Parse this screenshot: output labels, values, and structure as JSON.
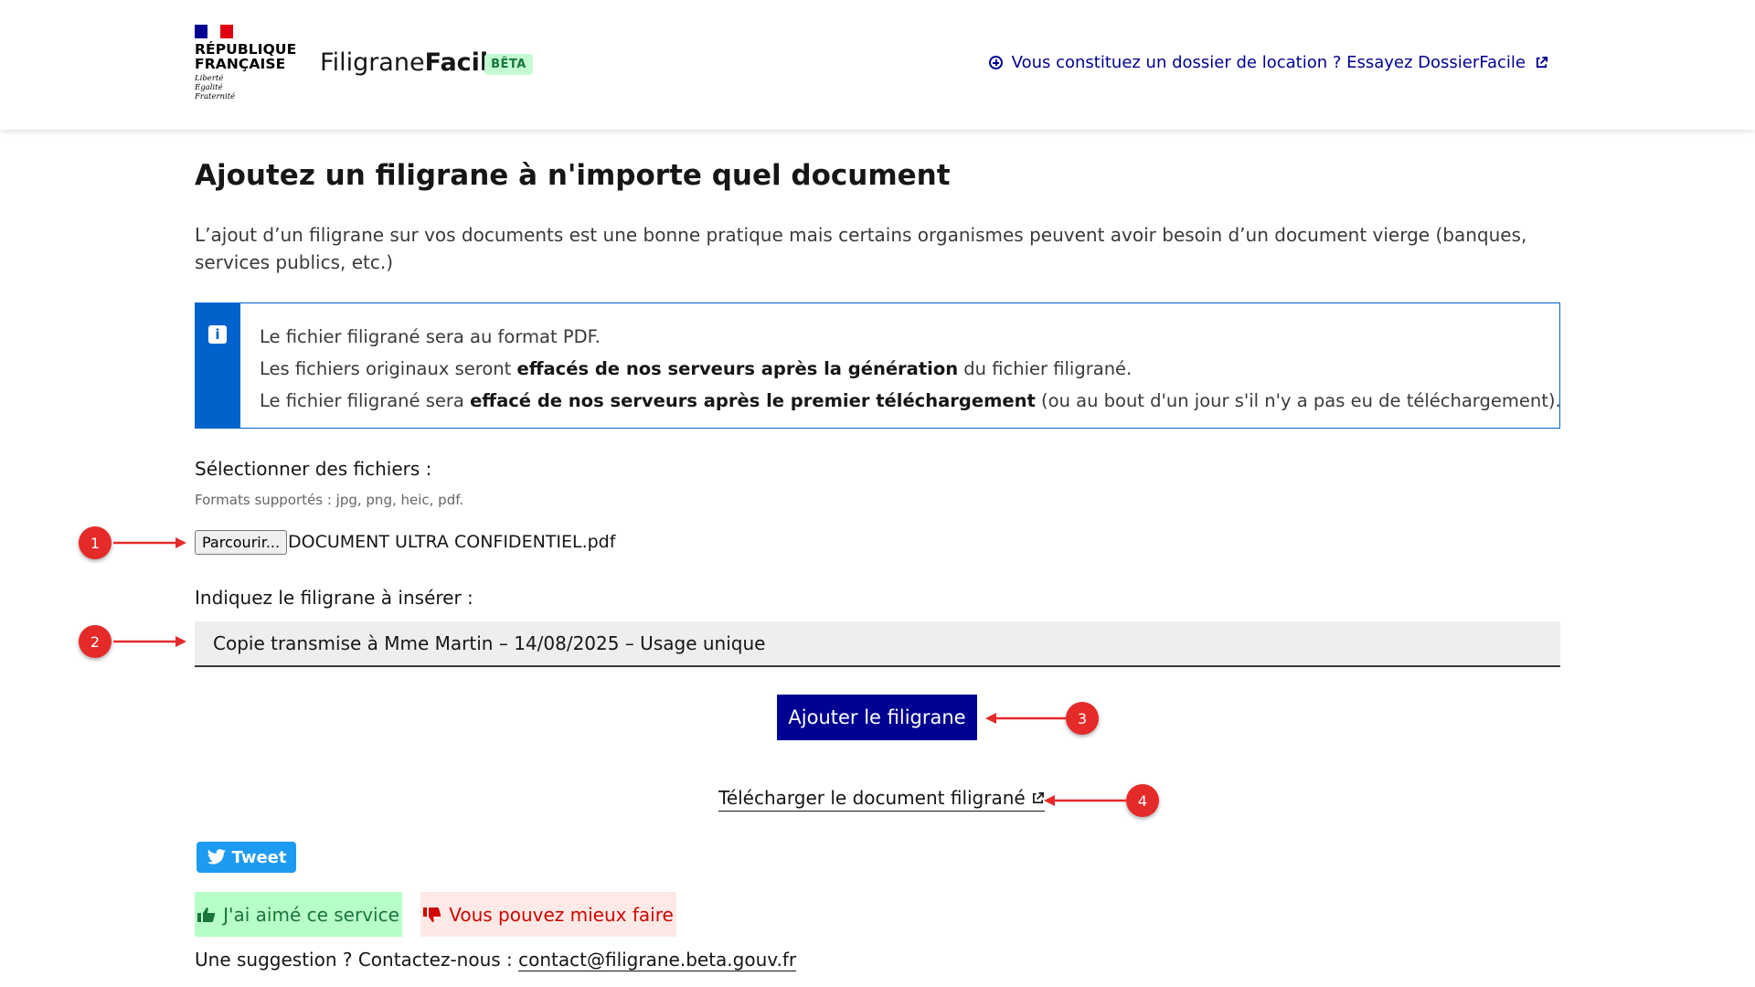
{
  "colors": {
    "flag_blue": "#000091",
    "flag_white": "#ffffff",
    "flag_red": "#e1000f",
    "primary": "#000091",
    "info_blue": "#0063cb",
    "beta_bg": "#c3fad5",
    "beta_text": "#18753c",
    "tweet_blue": "#1d9bf0",
    "like_bg": "#b8fec9",
    "dislike_bg": "#fee9e6",
    "annotation_red": "#e52a2a"
  },
  "header": {
    "logo": {
      "line1": "RÉPUBLIQUE",
      "line2": "FRANÇAISE",
      "motto1": "Liberté",
      "motto2": "Égalité",
      "motto3": "Fraternité"
    },
    "site_name_regular": "Filigrane",
    "site_name_bold": "Facile",
    "badge": "BÊTA",
    "link_text": "Vous constituez un dossier de location ? Essayez DossierFacile",
    "link_icon": "circle-plus-icon"
  },
  "main": {
    "title": "Ajoutez un filigrane à n'importe quel document",
    "intro": "L’ajout d’un filigrane sur vos documents est une bonne pratique mais certains organismes peuvent avoir besoin d’un document vierge (banques, services publics, etc.)",
    "alert": {
      "icon": "info-icon",
      "line1": "Le fichier filigrané sera au format PDF.",
      "line2_a": "Les fichiers originaux seront ",
      "line2_b": "effacés de nos serveurs après la génération",
      "line2_c": " du fichier filigrané.",
      "line3_a": "Le fichier filigrané sera ",
      "line3_b": "effacé de nos serveurs après le premier téléchargement",
      "line3_c": " (ou au bout d'un jour s'il n'y a pas eu de téléchargement)."
    },
    "file_section": {
      "label": "Sélectionner des fichiers :",
      "hint": "Formats supportés : jpg, png, heic, pdf.",
      "browse_label": "Parcourir...",
      "selected_file": "DOCUMENT ULTRA CONFIDENTIEL.pdf"
    },
    "watermark_section": {
      "label": "Indiquez le filigrane à insérer :",
      "value": "Copie transmise à Mme Martin – 14/08/2025 – Usage unique"
    },
    "submit_label": "Ajouter le filigrane",
    "download_label": "Télécharger le document filigrané"
  },
  "footer": {
    "tweet_label": "Tweet",
    "like_label": "J'ai aimé ce service",
    "dislike_label": "Vous pouvez mieux faire",
    "suggestion_text": "Une suggestion ? Contactez-nous : ",
    "contact_email": "contact@filigrane.beta.gouv.fr"
  },
  "annotations": [
    "1",
    "2",
    "3",
    "4"
  ]
}
